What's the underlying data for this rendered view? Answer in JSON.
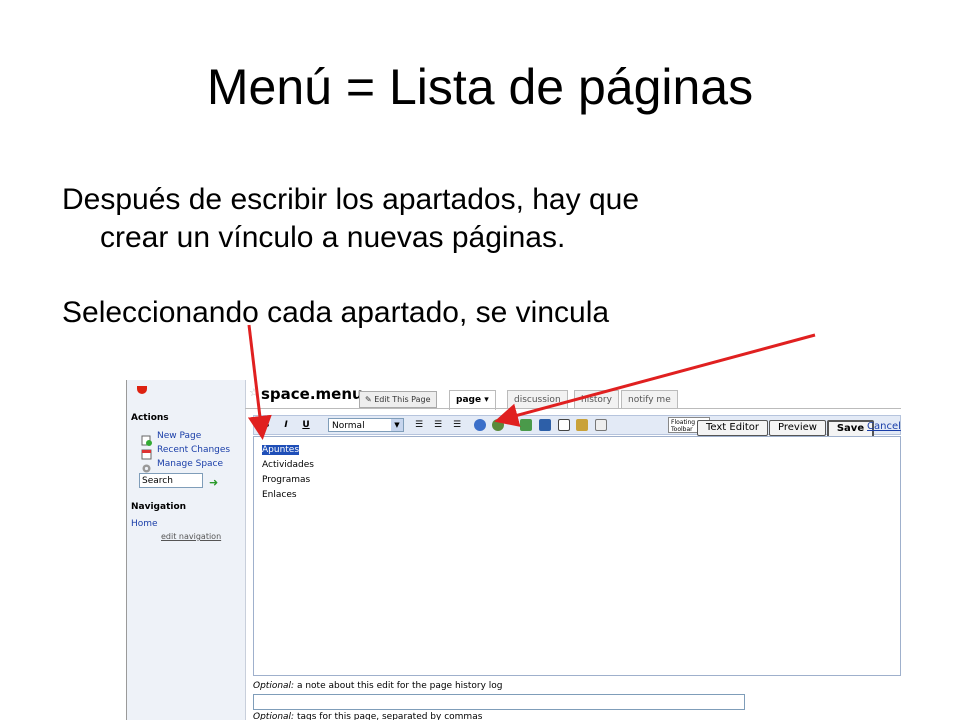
{
  "slide": {
    "title": "Menú = Lista de páginas",
    "bullet1_line1": "Después de escribir los apartados, hay que",
    "bullet1_line2": "crear un vínculo a nuevas páginas.",
    "bullet2": "Seleccionando cada apartado, se vincula"
  },
  "sidebar": {
    "actions_heading": "Actions",
    "actions": [
      {
        "label": "New Page",
        "icon": "new-page-icon"
      },
      {
        "label": "Recent Changes",
        "icon": "calendar-icon"
      },
      {
        "label": "Manage Space",
        "icon": "gear-icon"
      }
    ],
    "search_value": "Search",
    "navigation_heading": "Navigation",
    "home_link": "Home",
    "edit_navigation": "edit navigation"
  },
  "page": {
    "name": "space.menu",
    "edit_button": "Edit This Page",
    "tabs": [
      {
        "label": "page ▾",
        "active": true
      },
      {
        "label": "discussion",
        "active": false
      },
      {
        "label": "history",
        "active": false
      },
      {
        "label": "notify me",
        "active": false
      }
    ]
  },
  "toolbar": {
    "bold": "B",
    "italic": "I",
    "underline": "U",
    "format_value": "Normal",
    "floating_line1": "Floating",
    "floating_line2": "Toolbar",
    "text_editor": "Text Editor",
    "preview": "Preview",
    "save": "Save",
    "cancel": "Cancel"
  },
  "editor": {
    "lines": [
      "Apuntes",
      "Actividades",
      "Programas",
      "Enlaces"
    ]
  },
  "footer": {
    "optional_label": "Optional:",
    "note_text": "a note about this edit for the page history log",
    "tags_text": "tags for this page, separated by commas"
  },
  "colors": {
    "arrow": "#e02020",
    "link": "#1a3ea8",
    "selection": "#1f4fb8"
  }
}
